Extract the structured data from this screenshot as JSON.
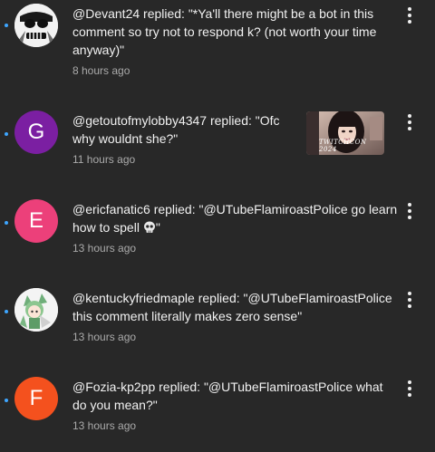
{
  "notifications": [
    {
      "text": "@Devant24 replied: \"*Ya'll there might be a bot in this comment so try not to respond k? (not worth your time anyway)\"",
      "time": "8 hours ago",
      "avatar_letter": "",
      "avatar_color": "#f2f2f2"
    },
    {
      "text": "@getoutofmylobby4347 replied: \"Ofc why wouldnt she?\"",
      "time": "11 hours ago",
      "avatar_letter": "G",
      "avatar_color": "#7b1fa2",
      "thumbnail_caption": "TWITCHCON 2024"
    },
    {
      "text": "@ericfanatic6 replied: \"@UTubeFlamiroastPolice go learn how to spell",
      "text_end": "\"",
      "time": "13 hours ago",
      "avatar_letter": "E",
      "avatar_color": "#ec407a",
      "emoji": "skull-emoji"
    },
    {
      "text": "@kentuckyfriedmaple replied: \"@UTubeFlamiroastPolice this comment literally makes zero sense\"",
      "time": "13 hours ago",
      "avatar_letter": "",
      "avatar_color": "#f4f4f4"
    },
    {
      "text": "@Fozia-kp2pp replied: \"@UTubeFlamiroastPolice what do you mean?\"",
      "time": "13 hours ago",
      "avatar_letter": "F",
      "avatar_color": "#f4511e"
    }
  ],
  "colors": {
    "background": "#282828",
    "text": "#f1f1f1",
    "secondary_text": "#aaaaaa",
    "unread_dot": "#3ea6ff"
  }
}
